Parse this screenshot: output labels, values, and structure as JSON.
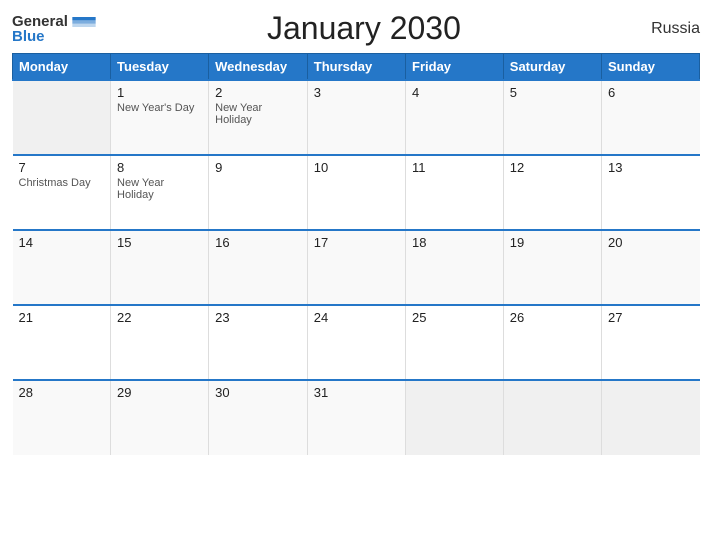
{
  "logo": {
    "general": "General",
    "blue": "Blue"
  },
  "title": "January 2030",
  "country": "Russia",
  "days_of_week": [
    "Monday",
    "Tuesday",
    "Wednesday",
    "Thursday",
    "Friday",
    "Saturday",
    "Sunday"
  ],
  "weeks": [
    [
      {
        "day": "",
        "holiday": "",
        "empty": true
      },
      {
        "day": "1",
        "holiday": "New Year's Day",
        "empty": false
      },
      {
        "day": "2",
        "holiday": "New Year Holiday",
        "empty": false
      },
      {
        "day": "3",
        "holiday": "",
        "empty": false
      },
      {
        "day": "4",
        "holiday": "",
        "empty": false
      },
      {
        "day": "5",
        "holiday": "",
        "empty": false
      },
      {
        "day": "6",
        "holiday": "",
        "empty": false
      }
    ],
    [
      {
        "day": "7",
        "holiday": "Christmas Day",
        "empty": false
      },
      {
        "day": "8",
        "holiday": "New Year Holiday",
        "empty": false
      },
      {
        "day": "9",
        "holiday": "",
        "empty": false
      },
      {
        "day": "10",
        "holiday": "",
        "empty": false
      },
      {
        "day": "11",
        "holiday": "",
        "empty": false
      },
      {
        "day": "12",
        "holiday": "",
        "empty": false
      },
      {
        "day": "13",
        "holiday": "",
        "empty": false
      }
    ],
    [
      {
        "day": "14",
        "holiday": "",
        "empty": false
      },
      {
        "day": "15",
        "holiday": "",
        "empty": false
      },
      {
        "day": "16",
        "holiday": "",
        "empty": false
      },
      {
        "day": "17",
        "holiday": "",
        "empty": false
      },
      {
        "day": "18",
        "holiday": "",
        "empty": false
      },
      {
        "day": "19",
        "holiday": "",
        "empty": false
      },
      {
        "day": "20",
        "holiday": "",
        "empty": false
      }
    ],
    [
      {
        "day": "21",
        "holiday": "",
        "empty": false
      },
      {
        "day": "22",
        "holiday": "",
        "empty": false
      },
      {
        "day": "23",
        "holiday": "",
        "empty": false
      },
      {
        "day": "24",
        "holiday": "",
        "empty": false
      },
      {
        "day": "25",
        "holiday": "",
        "empty": false
      },
      {
        "day": "26",
        "holiday": "",
        "empty": false
      },
      {
        "day": "27",
        "holiday": "",
        "empty": false
      }
    ],
    [
      {
        "day": "28",
        "holiday": "",
        "empty": false
      },
      {
        "day": "29",
        "holiday": "",
        "empty": false
      },
      {
        "day": "30",
        "holiday": "",
        "empty": false
      },
      {
        "day": "31",
        "holiday": "",
        "empty": false
      },
      {
        "day": "",
        "holiday": "",
        "empty": true
      },
      {
        "day": "",
        "holiday": "",
        "empty": true
      },
      {
        "day": "",
        "holiday": "",
        "empty": true
      }
    ]
  ]
}
